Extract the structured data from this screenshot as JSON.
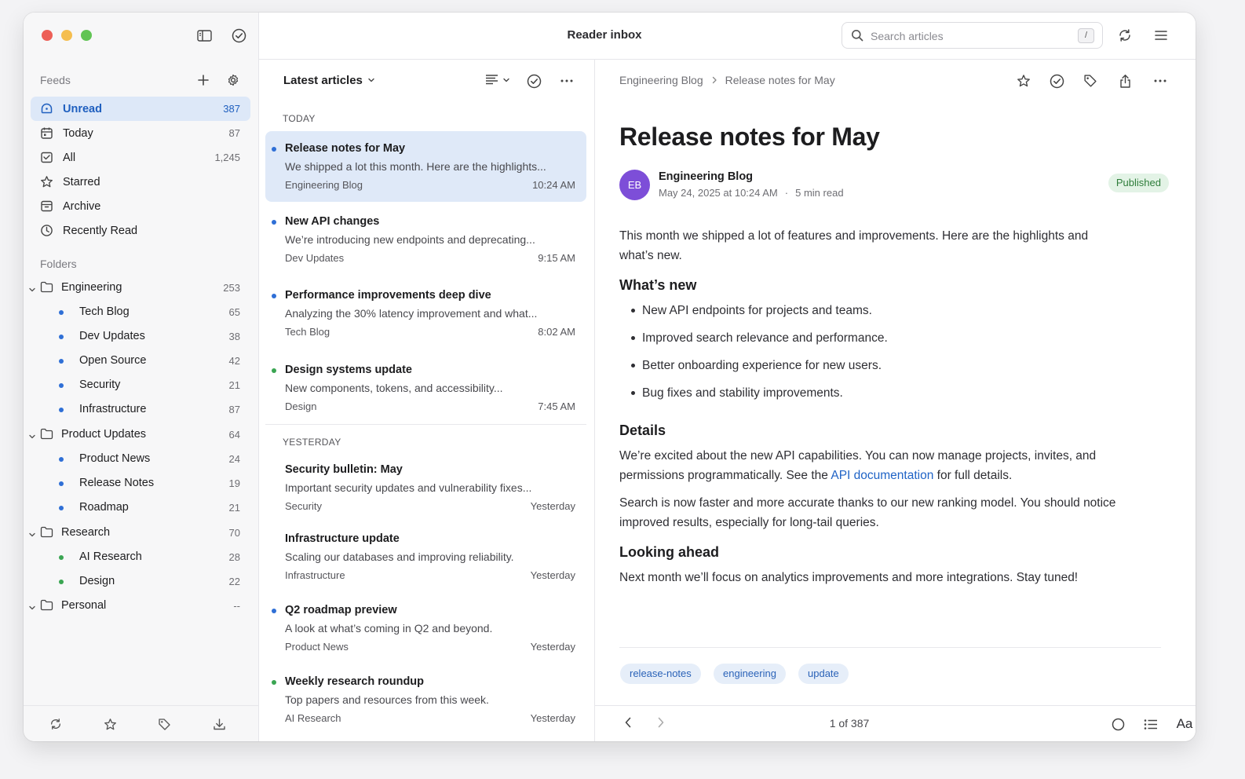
{
  "window": {
    "title": "Reader inbox",
    "search": {
      "placeholder": "Search articles",
      "shortcut": "/"
    }
  },
  "sidebar": {
    "feeds_label": "Feeds",
    "items": [
      {
        "label": "Unread",
        "count": "387",
        "icon": "unread-icon",
        "active": true
      },
      {
        "label": "Today",
        "count": "87",
        "icon": "calendar-icon"
      },
      {
        "label": "All",
        "count": "1,245",
        "icon": "inbox-icon"
      },
      {
        "label": "Starred",
        "count": "",
        "icon": "star-icon"
      },
      {
        "label": "Archive",
        "count": "",
        "icon": "archive-icon"
      },
      {
        "label": "Recently Read",
        "count": "",
        "icon": "clock-icon"
      }
    ],
    "folders_label": "Folders",
    "folders": [
      {
        "label": "Engineering",
        "count": "253",
        "feeds": [
          {
            "label": "Tech Blog",
            "count": "65",
            "color": "#2f6fd6"
          },
          {
            "label": "Dev Updates",
            "count": "38",
            "color": "#2f6fd6"
          },
          {
            "label": "Open Source",
            "count": "42",
            "color": "#2f6fd6"
          },
          {
            "label": "Security",
            "count": "21",
            "color": "#2f6fd6"
          },
          {
            "label": "Infrastructure",
            "count": "87",
            "color": "#2f6fd6"
          }
        ]
      },
      {
        "label": "Product Updates",
        "count": "64",
        "feeds": [
          {
            "label": "Product News",
            "count": "24",
            "color": "#2f6fd6"
          },
          {
            "label": "Release Notes",
            "count": "19",
            "color": "#2f6fd6"
          },
          {
            "label": "Roadmap",
            "count": "21",
            "color": "#2f6fd6"
          }
        ]
      },
      {
        "label": "Research",
        "count": "70",
        "feeds": [
          {
            "label": "AI Research",
            "count": "28",
            "color": "#3aa552"
          },
          {
            "label": "Design",
            "count": "22",
            "color": "#3aa552"
          }
        ]
      },
      {
        "label": "Personal",
        "count": "--",
        "feeds": []
      }
    ]
  },
  "list": {
    "title": "Latest articles",
    "sections": [
      {
        "label": "TODAY",
        "articles": [
          {
            "title": "Release notes for May",
            "snippet": "We shipped a lot this month. Here are the highlights...",
            "source": "Engineering Blog",
            "time": "10:24 AM",
            "dot": "#2f6fd6",
            "selected": true
          },
          {
            "title": "New API changes",
            "snippet": "We’re introducing new endpoints and deprecating...",
            "source": "Dev Updates",
            "time": "9:15 AM",
            "dot": "#2f6fd6"
          },
          {
            "title": "Performance improvements deep dive",
            "snippet": "Analyzing the 30% latency improvement and what...",
            "source": "Tech Blog",
            "time": "8:02 AM",
            "dot": "#2f6fd6"
          },
          {
            "title": "Design systems update",
            "snippet": "New components, tokens, and accessibility...",
            "source": "Design",
            "time": "7:45 AM",
            "dot": "#3aa552"
          }
        ]
      },
      {
        "label": "YESTERDAY",
        "articles": [
          {
            "title": "Security bulletin: May",
            "snippet": "Important security updates and vulnerability fixes...",
            "source": "Security",
            "time": "Yesterday",
            "dot": ""
          },
          {
            "title": "Infrastructure update",
            "snippet": "Scaling our databases and improving reliability.",
            "source": "Infrastructure",
            "time": "Yesterday",
            "dot": ""
          },
          {
            "title": "Q2 roadmap preview",
            "snippet": "A look at what’s coming in Q2 and beyond.",
            "source": "Product News",
            "time": "Yesterday",
            "dot": "#2f6fd6"
          },
          {
            "title": "Weekly research roundup",
            "snippet": "Top papers and resources from this week.",
            "source": "AI Research",
            "time": "Yesterday",
            "dot": "#3aa552"
          }
        ]
      }
    ]
  },
  "reader": {
    "breadcrumb": [
      "Engineering Blog",
      "Release notes for May"
    ],
    "title": "Release notes for May",
    "avatar_initials": "EB",
    "author": "Engineering Blog",
    "date": "May 24, 2025 at 10:24 AM",
    "meta_sep": "·",
    "read_time": "5 min read",
    "status": "Published",
    "intro": "This month we shipped a lot of features and improvements. Here are the highlights and what’s new.",
    "whats_new_heading": "What’s new",
    "whats_new_items": [
      "New API endpoints for projects and teams.",
      "Improved search relevance and performance.",
      "Better onboarding experience for new users.",
      "Bug fixes and stability improvements."
    ],
    "details_heading": "Details",
    "details_p1_before": "We’re excited about the new API capabilities. You can now manage projects, invites, and permissions programmatically. See the ",
    "details_p1_link": "API documentation",
    "details_p1_after": " for full details.",
    "details_p2": "Search is now faster and more accurate thanks to our new ranking model. You should notice improved results, especially for long-tail queries.",
    "looking_heading": "Looking ahead",
    "looking_p": "Next month we’ll focus on analytics improvements and more integrations. Stay tuned!",
    "tags": [
      "release-notes",
      "engineering",
      "update"
    ],
    "pager": "1 of 387",
    "font_button": "Aa"
  },
  "colors": {
    "accent": "#1f5fbf",
    "selected_bg": "#dfe9f8",
    "published_bg": "#e3f3e6",
    "avatar_bg": "#7d4ed8"
  }
}
